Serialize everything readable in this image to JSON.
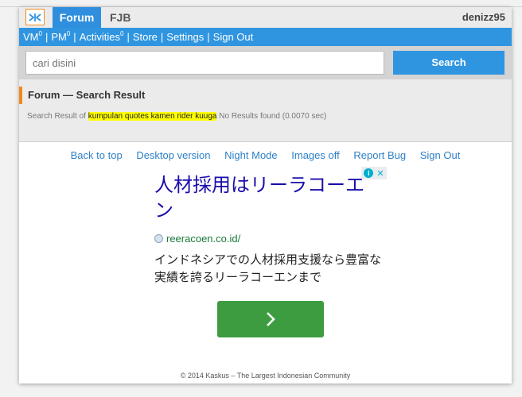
{
  "header": {
    "logo_icon": "kaskus-logo-icon",
    "tabs": [
      "Forum",
      "FJB"
    ],
    "username": "denizz95"
  },
  "nav": {
    "items": [
      {
        "label": "VM",
        "count": "0"
      },
      {
        "label": "PM",
        "count": "0"
      },
      {
        "label": "Activities",
        "count": "0"
      },
      {
        "label": "Store"
      },
      {
        "label": "Settings"
      },
      {
        "label": "Sign Out"
      }
    ],
    "separator": "|"
  },
  "search": {
    "placeholder": "cari disini",
    "button_label": "Search"
  },
  "result": {
    "title": "Forum — Search Result",
    "prefix": "Search Result of",
    "query": "kumpulan quotes kamen rider kuuga",
    "status": "No Results found (0.0070 sec)"
  },
  "footer_links": [
    "Back to top",
    "Desktop version",
    "Night Mode",
    "Images off",
    "Report Bug",
    "Sign Out"
  ],
  "ad": {
    "title": "人材採用はリーラコーエン",
    "url": "reeracoen.co.id/",
    "description": "インドネシアでの人材採用支援なら豊富な実績を誇るリーラコーエンまで",
    "badge_info": "i",
    "badge_close": "✕",
    "cta_icon": "chevron-right-icon"
  },
  "copyright": "© 2014 Kaskus – The Largest Indonesian Community",
  "colors": {
    "primary_blue": "#2f95e0",
    "accent_orange": "#f08a1d",
    "link_blue": "#2f80c8",
    "ad_green": "#3d9c40",
    "highlight_yellow": "#ffff00"
  }
}
